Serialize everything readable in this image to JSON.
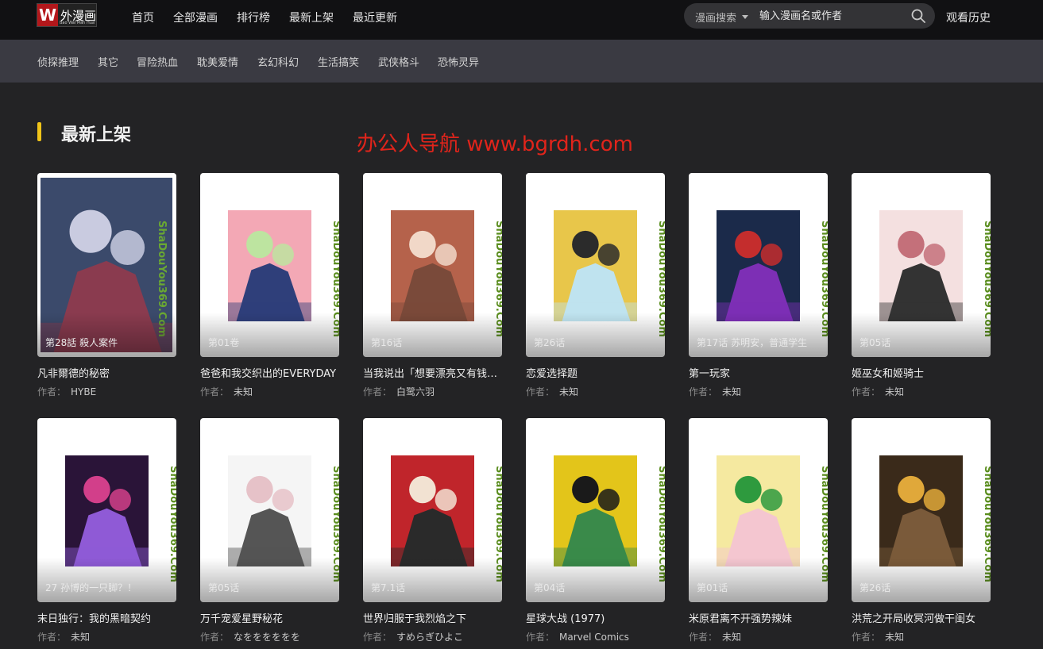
{
  "header": {
    "logo_text": "外漫画",
    "logo_mark": "W",
    "logo_sub": "Bao Wai Man Hua",
    "nav": [
      "首页",
      "全部漫画",
      "排行榜",
      "最新上架",
      "最近更新"
    ],
    "search_scope": "漫画搜索",
    "search_placeholder": "输入漫画名或作者",
    "history": "观看历史"
  },
  "categories": [
    "侦探推理",
    "其它",
    "冒险热血",
    "耽美爱情",
    "玄幻科幻",
    "生活搞笑",
    "武侠格斗",
    "恐怖灵异"
  ],
  "section": {
    "title": "最新上架"
  },
  "promo": "办公人导航 www.bgrdh.com",
  "watermark": "ShaDouYou369.Com",
  "author_label": "作者：",
  "comics": [
    {
      "title": "凡非爾德的秘密",
      "chapter": "第28話 殺人案件",
      "author": "HYBE",
      "palette": [
        "#3b4a6b",
        "#c9cbe0",
        "#8a3b4f"
      ],
      "full": true
    },
    {
      "title": "爸爸和我交织出的EVERYDAY",
      "chapter": "第01卷",
      "author": "未知",
      "palette": [
        "#f3a8b5",
        "#bde4a0",
        "#2f3f7a"
      ],
      "full": false
    },
    {
      "title": "当我说出「想要漂亮又有钱的女友」",
      "chapter": "第16话",
      "author": "白鹭六羽",
      "palette": [
        "#b5624b",
        "#f1d8c8",
        "#7a4a3a"
      ],
      "full": false
    },
    {
      "title": "恋爱选择题",
      "chapter": "第26话",
      "author": "未知",
      "palette": [
        "#e8c64a",
        "#2b2b2b",
        "#bfe3ef"
      ],
      "full": false
    },
    {
      "title": "第一玩家",
      "chapter": "第17话 苏明安，普通学生",
      "author": "未知",
      "palette": [
        "#1b2a4a",
        "#c42d2d",
        "#7d2fb5"
      ],
      "full": false
    },
    {
      "title": "姬巫女和姬骑士",
      "chapter": "第05话",
      "author": "未知",
      "palette": [
        "#f4e0e0",
        "#c4707a",
        "#333333"
      ],
      "full": false
    },
    {
      "title": "末日独行：我的黑暗契约",
      "chapter": "27 孙博的一只脚？！",
      "author": "未知",
      "palette": [
        "#2a1438",
        "#d23f8a",
        "#8f5ad6"
      ],
      "full": false
    },
    {
      "title": "万千宠爱星野秘花",
      "chapter": "第05话",
      "author": "なをををををを",
      "palette": [
        "#f5f5f5",
        "#e6c2c8",
        "#555555"
      ],
      "full": false
    },
    {
      "title": "世界归服于我烈焰之下",
      "chapter": "第7.1话",
      "author": "すめらぎひよこ",
      "palette": [
        "#c0252b",
        "#f2e2d2",
        "#2a2a2a"
      ],
      "full": false
    },
    {
      "title": "星球大战 (1977)",
      "chapter": "第04话",
      "author": "Marvel Comics",
      "palette": [
        "#e3c51a",
        "#1a1a1a",
        "#3a8a4a"
      ],
      "full": false
    },
    {
      "title": "米原君离不开强势辣妹",
      "chapter": "第01话",
      "author": "未知",
      "palette": [
        "#f5e9a0",
        "#2e9a3e",
        "#f4c6d0"
      ],
      "full": false
    },
    {
      "title": "洪荒之开局收冥河做干闺女",
      "chapter": "第26话",
      "author": "未知",
      "palette": [
        "#3a2a1a",
        "#e0a83a",
        "#7a5a3a"
      ],
      "full": false
    }
  ]
}
